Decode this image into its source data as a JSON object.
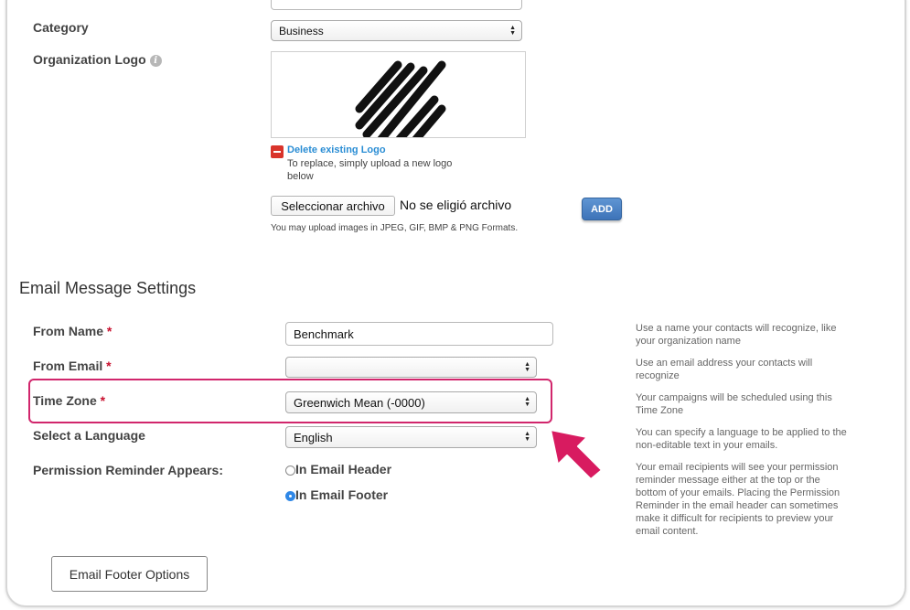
{
  "organization": {
    "category_label": "Category",
    "category_value": "Business",
    "logo_label": "Organization Logo",
    "delete_logo_label": "Delete existing Logo",
    "replace_hint_line1": "To replace, simply upload a new logo",
    "replace_hint_line2": "below",
    "choose_file_label": "Seleccionar archivo",
    "no_file_text": "No se eligió archivo",
    "add_button_label": "ADD",
    "formats_hint": "You may upload images in JPEG, GIF, BMP & PNG Formats."
  },
  "email_settings": {
    "section_title": "Email Message Settings",
    "from_name_label": "From Name",
    "from_name_value": "Benchmark",
    "from_name_help_1": "Use a name your contacts will recognize, like",
    "from_name_help_2": "your organization name",
    "from_email_label": "From Email",
    "from_email_value": "",
    "from_email_help_1": "Use an email address your contacts will",
    "from_email_help_2": "recognize",
    "time_zone_label": "Time Zone",
    "time_zone_value": "Greenwich Mean (-0000)",
    "time_zone_help_1": "Your campaigns will be scheduled using this",
    "time_zone_help_2": "Time Zone",
    "language_label": "Select a Language",
    "language_value": "English",
    "language_help_1": "You can specify a language to be applied to the",
    "language_help_2": "non-editable text in your emails.",
    "permission_label": "Permission Reminder Appears:",
    "permission_option_header": "In Email Header",
    "permission_option_footer": "In Email Footer",
    "permission_selected": "In Email Footer",
    "permission_help_1": "Your email recipients will see your permission",
    "permission_help_2": "reminder message either at the top or the",
    "permission_help_3": "bottom of your emails. Placing the Permission",
    "permission_help_4": "Reminder in the email header can sometimes",
    "permission_help_5": "make it difficult for recipients to preview your",
    "permission_help_6": "email content.",
    "required_marker": "*",
    "footer_button_label": "Email Footer Options"
  },
  "colors": {
    "highlight": "#d1266c",
    "arrow": "#d81b60",
    "add_button": "#4a80c4",
    "delete_icon": "#d9342b",
    "link": "#2a8dd4",
    "radio_selected": "#2f87e6"
  }
}
